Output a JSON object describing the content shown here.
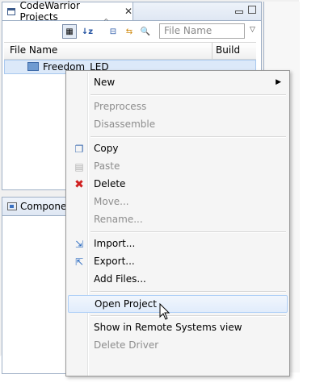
{
  "projects_view": {
    "tab_title": "CodeWarrior Projects",
    "filter_placeholder": "File Name",
    "columns": [
      "File Name",
      "Build"
    ],
    "tree": [
      {
        "label": "Freedom_LED"
      }
    ]
  },
  "bottom_view": {
    "tab_title": "Compone"
  },
  "context_menu": {
    "items": [
      {
        "label": "New",
        "enabled": true,
        "submenu": true
      },
      {
        "label": "Preprocess",
        "enabled": false
      },
      {
        "label": "Disassemble",
        "enabled": false
      },
      {
        "label": "Copy",
        "enabled": true,
        "icon": "copy-icon"
      },
      {
        "label": "Paste",
        "enabled": false,
        "icon": "paste-icon"
      },
      {
        "label": "Delete",
        "enabled": true,
        "icon": "delete-icon"
      },
      {
        "label": "Move...",
        "enabled": false
      },
      {
        "label": "Rename...",
        "enabled": false
      },
      {
        "label": "Import...",
        "enabled": true,
        "icon": "import-icon"
      },
      {
        "label": "Export...",
        "enabled": true,
        "icon": "export-icon"
      },
      {
        "label": "Add Files...",
        "enabled": true
      },
      {
        "label": "Open Project",
        "enabled": true,
        "highlighted": true
      },
      {
        "label": "Show in Remote Systems view",
        "enabled": true
      },
      {
        "label": "Delete Driver",
        "enabled": false
      }
    ]
  },
  "colors": {
    "selection": "#dce9f9",
    "menu_highlight": "#aecff7",
    "delete_icon": "#d02020"
  }
}
